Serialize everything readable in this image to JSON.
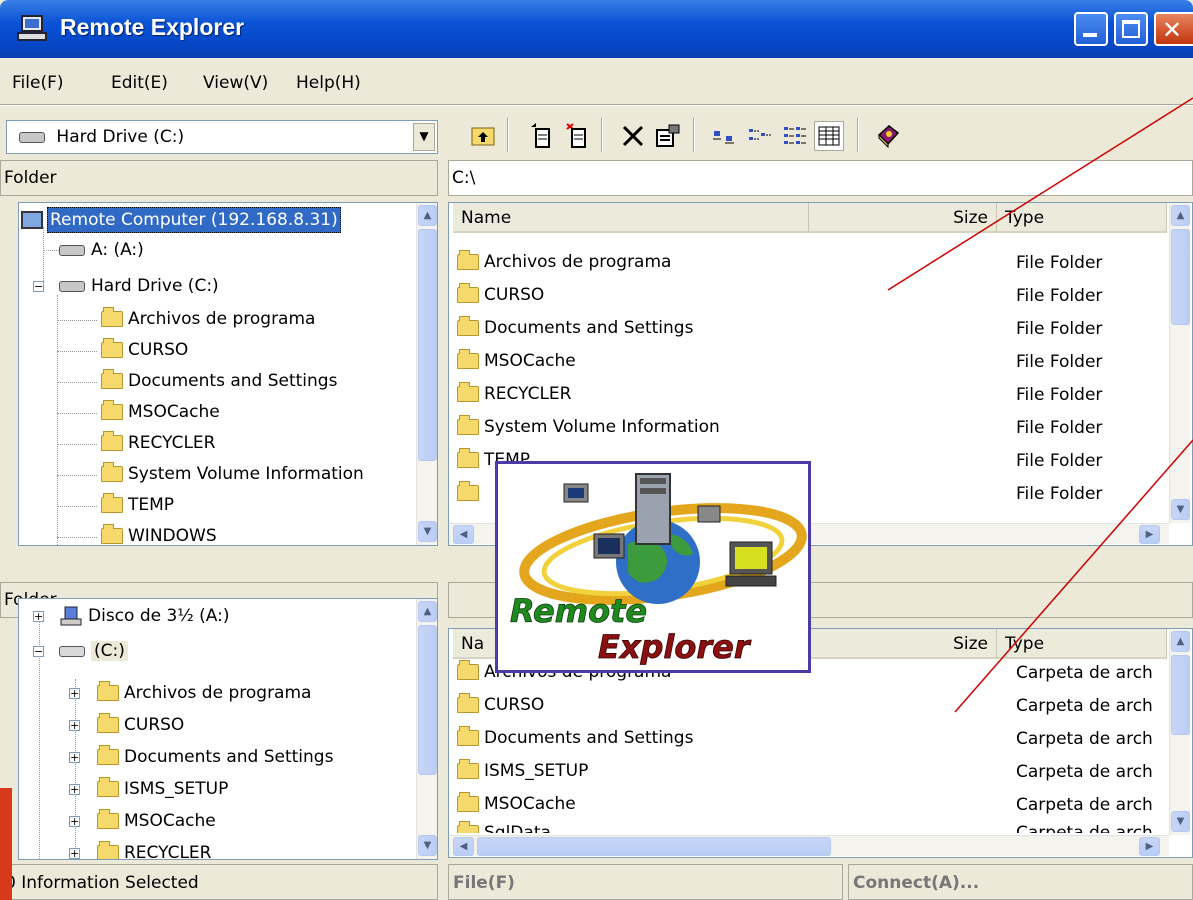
{
  "window": {
    "title": "Remote Explorer"
  },
  "menu": [
    "File(F)",
    "Edit(E)",
    "View(V)",
    "Help(H)"
  ],
  "drive_combo": {
    "value": "Hard Drive (C:)"
  },
  "top": {
    "folder_label": "Folder",
    "path": "C:\\",
    "tree": [
      {
        "label": "Remote Computer (192.168.8.31)",
        "kind": "computer"
      },
      {
        "label": "A: (A:)",
        "kind": "drive"
      },
      {
        "label": "Hard Drive (C:)",
        "kind": "drive"
      },
      {
        "label": "Archivos de programa",
        "kind": "folder"
      },
      {
        "label": "CURSO",
        "kind": "folder"
      },
      {
        "label": "Documents and Settings",
        "kind": "folder"
      },
      {
        "label": "MSOCache",
        "kind": "folder"
      },
      {
        "label": "RECYCLER",
        "kind": "folder"
      },
      {
        "label": "System Volume Information",
        "kind": "folder"
      },
      {
        "label": "TEMP",
        "kind": "folder"
      },
      {
        "label": "WINDOWS",
        "kind": "folder"
      }
    ],
    "columns": {
      "name": "Name",
      "size": "Size",
      "type": "Type"
    },
    "files": [
      {
        "name": "Archivos de programa",
        "type": "File Folder"
      },
      {
        "name": "CURSO",
        "type": "File Folder"
      },
      {
        "name": "Documents and Settings",
        "type": "File Folder"
      },
      {
        "name": "MSOCache",
        "type": "File Folder"
      },
      {
        "name": "RECYCLER",
        "type": "File Folder"
      },
      {
        "name": "System Volume Information",
        "type": "File Folder"
      },
      {
        "name": "TEMP",
        "type": "File Folder"
      },
      {
        "name": "",
        "type": "File Folder"
      }
    ]
  },
  "bottom": {
    "folder_label": "Folder",
    "tree": [
      {
        "label": "Disco de 3½ (A:)",
        "kind": "floppy"
      },
      {
        "label": "(C:)",
        "kind": "drive"
      },
      {
        "label": "Archivos de programa",
        "kind": "folder"
      },
      {
        "label": "CURSO",
        "kind": "folder"
      },
      {
        "label": "Documents and Settings",
        "kind": "folder"
      },
      {
        "label": "ISMS_SETUP",
        "kind": "folder"
      },
      {
        "label": "MSOCache",
        "kind": "folder"
      },
      {
        "label": "RECYCLER",
        "kind": "folder"
      }
    ],
    "columns": {
      "name": "Na",
      "size": "Size",
      "type": "Type"
    },
    "files": [
      {
        "name": "Archivos de programa",
        "type": "Carpeta de arch"
      },
      {
        "name": "CURSO",
        "type": "Carpeta de arch"
      },
      {
        "name": "Documents and Settings",
        "type": "Carpeta de arch"
      },
      {
        "name": "ISMS_SETUP",
        "type": "Carpeta de arch"
      },
      {
        "name": "MSOCache",
        "type": "Carpeta de arch"
      },
      {
        "name": "SqlData",
        "type": "Carpeta de arch"
      }
    ]
  },
  "statusbar": {
    "info": "0 Information Selected",
    "file": "File(F)",
    "connect": "Connect(A)..."
  },
  "logo": {
    "line1": "Remote",
    "line2": "Explorer"
  },
  "colors": {
    "title_blue": "#0a52d6",
    "logo_green": "#1f8a1f",
    "logo_red": "#8b1010",
    "annotation_red": "#cc0000"
  }
}
